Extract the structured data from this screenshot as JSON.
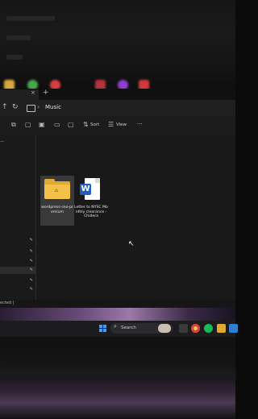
{
  "explorer": {
    "tab_close": "×",
    "tab_add": "+",
    "address": {
      "current_folder": "Music"
    },
    "commandbar": {
      "sort_label": "Sort",
      "view_label": "View",
      "more_label": "···"
    },
    "files": [
      {
        "name": "wordpress-seo-premium",
        "type": "folder"
      },
      {
        "name": "Letter to NYSC Monthly clearance - Chidera",
        "type": "word-document"
      }
    ],
    "status": {
      "text": "ected |"
    }
  },
  "taskbar": {
    "search_label": "Search"
  },
  "icons": {
    "back": "←",
    "up": "↑",
    "refresh": "↻",
    "forward": "›",
    "pin": "✎",
    "sort": "⇅",
    "view": "☰",
    "search": "⌕",
    "word": "W",
    "cursor": "↖"
  },
  "colors": {
    "folder": "#f3c14a",
    "word": "#1f5fbf",
    "accent": "#3aa0ff"
  }
}
